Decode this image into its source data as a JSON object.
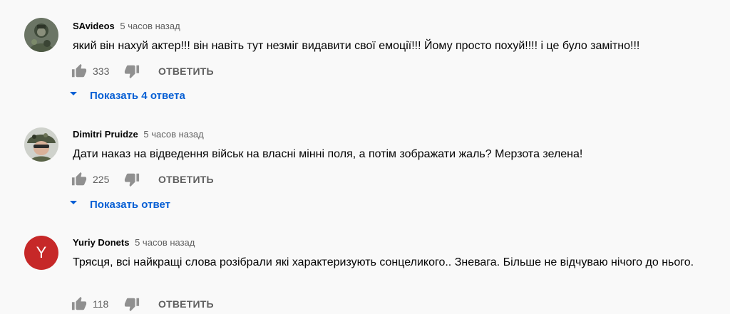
{
  "comments": [
    {
      "author": "SAvideos",
      "time": "5 часов назад",
      "text": "який він нахуй актер!!! він навіть тут незміг видавити свої емоції!!! Йому просто похуй!!!! і це було замітно!!!",
      "likes": "333",
      "reply_label": "ОТВЕТИТЬ",
      "replies_label": "Показать 4 ответа",
      "avatar_icon": "camo-soldier-photo"
    },
    {
      "author": "Dimitri Pruidze",
      "time": "5 часов назад",
      "text": "Дати наказ на відведення військ на власні мінні поля, а потім зображати жаль? Мерзота зелена!",
      "likes": "225",
      "reply_label": "ОТВЕТИТЬ",
      "replies_label": "Показать ответ",
      "avatar_icon": "helmet-soldier-photo"
    },
    {
      "author": "Yuriy Donets",
      "time": "5 часов назад",
      "text": "Трясця, всі найкращі слова розібрали які характеризують сонцеликого.. Зневага. Більше не відчуваю нічого до нього.",
      "likes": "118",
      "reply_label": "ОТВЕТИТЬ",
      "avatar_letter": "Y",
      "avatar_color": "#c62828"
    }
  ],
  "colors": {
    "link_blue": "#065fd4",
    "meta_gray": "#606060",
    "icon_gray": "#909090"
  }
}
